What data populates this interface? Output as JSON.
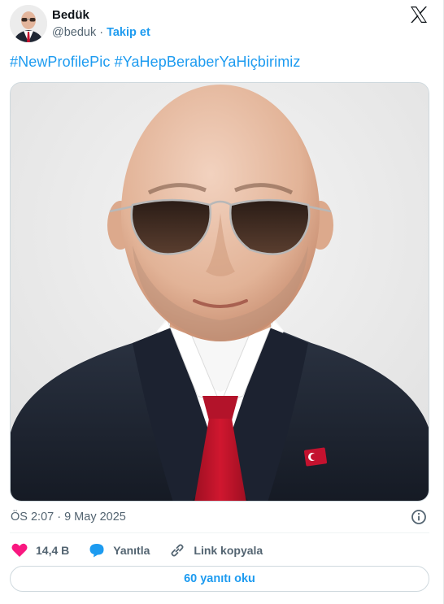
{
  "author": {
    "name": "Bedük",
    "handle": "@beduk",
    "separator": "·",
    "follow_label": "Takip et"
  },
  "tweet": {
    "hashtags": [
      "#NewProfilePic",
      "#YaHepBeraberYaHiçbirimiz"
    ]
  },
  "meta": {
    "timestamp": "ÖS 2:07 · 9 May 2025"
  },
  "actions": {
    "like_count": "14,4 B",
    "reply_label": "Yanıtla",
    "copy_link_label": "Link kopyala"
  },
  "footer": {
    "read_replies_label": "60 yanıtı oku"
  },
  "colors": {
    "accent": "#1d9bf0",
    "like": "#f91880",
    "text_secondary": "#536471",
    "border": "#cfd9de"
  },
  "icons": [
    "profile-avatar",
    "x-logo-icon",
    "info-icon",
    "heart-icon",
    "reply-bubble-icon",
    "link-icon"
  ]
}
